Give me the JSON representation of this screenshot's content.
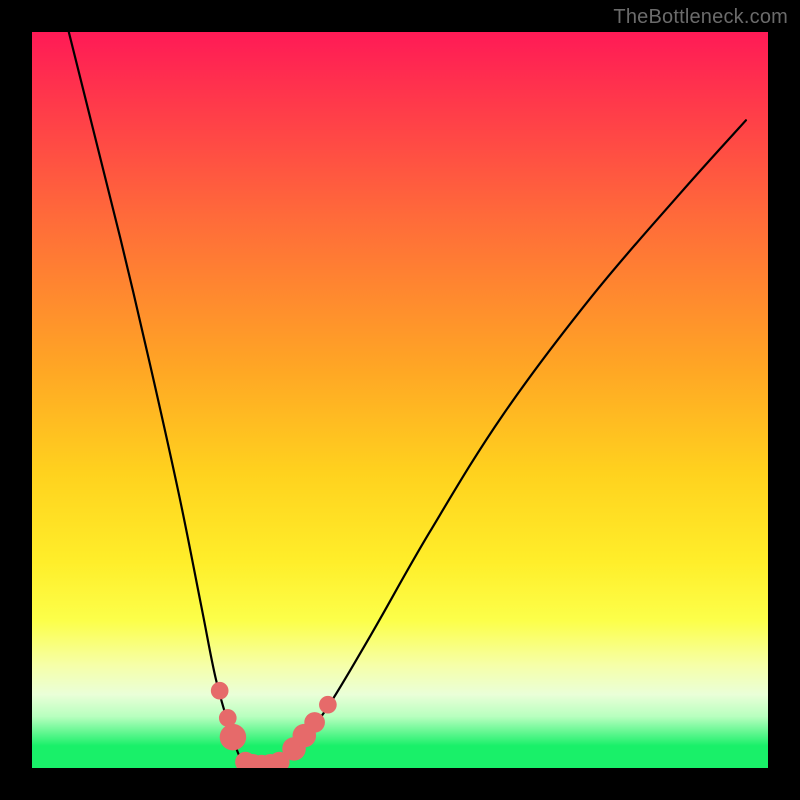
{
  "watermark": "TheBottleneck.com",
  "chart_data": {
    "type": "line",
    "title": "",
    "xlabel": "",
    "ylabel": "",
    "xlim": [
      0,
      100
    ],
    "ylim": [
      0,
      100
    ],
    "grid": false,
    "legend": false,
    "series": [
      {
        "name": "bottleneck-curve",
        "x": [
          5,
          8,
          12,
          16,
          20,
          23,
          25,
          27,
          28.5,
          30,
          32,
          34,
          36,
          40,
          46,
          54,
          64,
          76,
          88,
          97
        ],
        "y": [
          100,
          88,
          72,
          55,
          37,
          22,
          12,
          5,
          1,
          0,
          0,
          1,
          3,
          8,
          18,
          32,
          48,
          64,
          78,
          88
        ]
      }
    ],
    "markers": [
      {
        "x": 25.5,
        "y": 10.5,
        "r": 1.2
      },
      {
        "x": 26.6,
        "y": 6.8,
        "r": 1.2
      },
      {
        "x": 27.3,
        "y": 4.2,
        "r": 1.8
      },
      {
        "x": 29.0,
        "y": 0.8,
        "r": 1.4
      },
      {
        "x": 30.0,
        "y": 0.5,
        "r": 1.4
      },
      {
        "x": 31.2,
        "y": 0.4,
        "r": 1.4
      },
      {
        "x": 32.4,
        "y": 0.5,
        "r": 1.4
      },
      {
        "x": 33.6,
        "y": 0.8,
        "r": 1.4
      },
      {
        "x": 35.6,
        "y": 2.6,
        "r": 1.6
      },
      {
        "x": 37.0,
        "y": 4.4,
        "r": 1.6
      },
      {
        "x": 38.4,
        "y": 6.2,
        "r": 1.4
      },
      {
        "x": 40.2,
        "y": 8.6,
        "r": 1.2
      }
    ],
    "colors": {
      "curve": "#000000",
      "marker": "#e66a6a"
    }
  }
}
